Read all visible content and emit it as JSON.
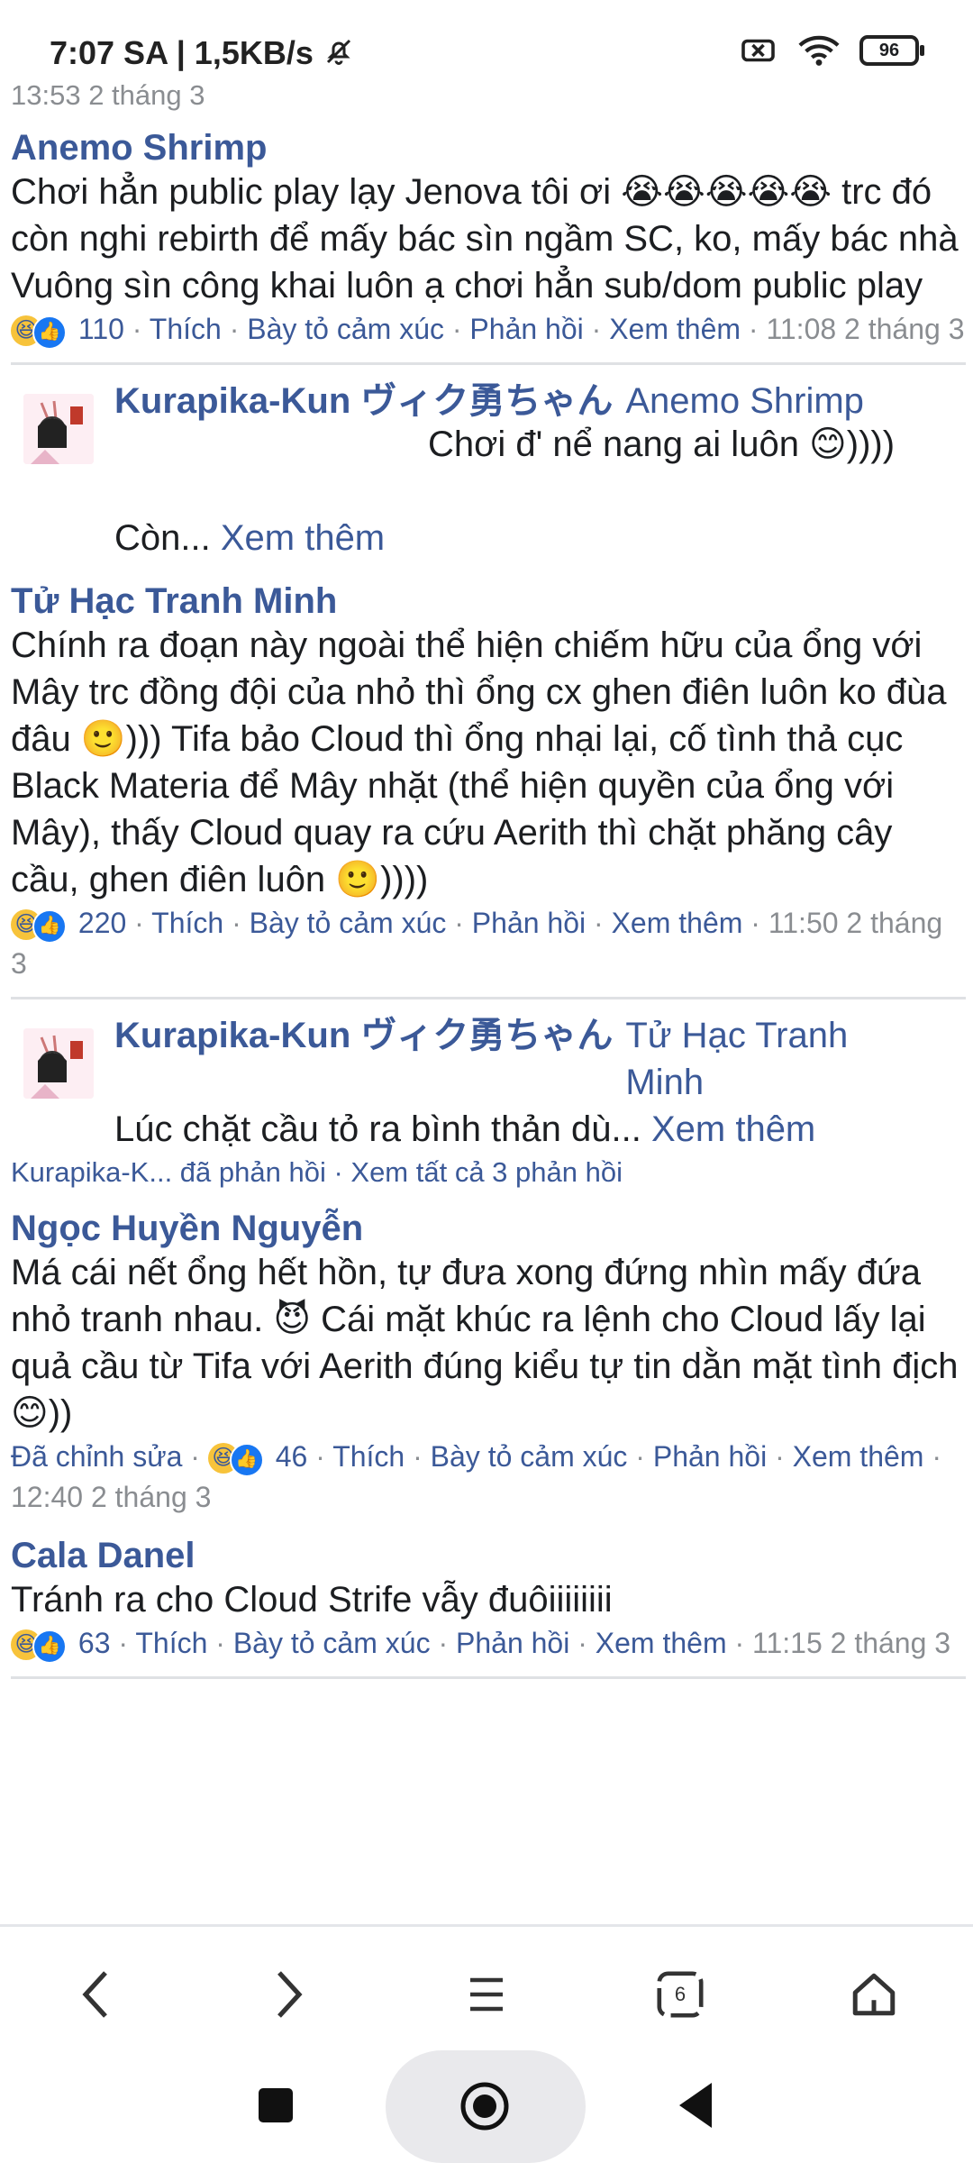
{
  "status_bar": {
    "time_speed": "7:07 SA | 1,5KB/s",
    "battery": "96",
    "icons": [
      "bell-off-icon",
      "battery-x-icon",
      "wifi-icon",
      "battery-icon"
    ]
  },
  "top_timestamp": "13:53 2 tháng 3",
  "comments": [
    {
      "author": "Anemo Shrimp",
      "text_a": "Chơi hẳn public play lạy Jenova tôi ơi ",
      "emojis": "😭😭😭😭😭",
      "text_b": " trc đó còn nghi rebirth để mấy bác sìn ngầm SC, ko, mấy bác nhà Vuông sìn công khai luôn ạ chơi hẳn sub/dom public play",
      "count": "110",
      "like": "Thích",
      "react": "Bày tỏ cảm xúc",
      "reply": "Phản hồi",
      "more": "Xem thêm",
      "time": "11:08 2 tháng 3"
    },
    {
      "author": "Tử Hạc Tranh Minh",
      "text": "Chính ra đoạn này ngoài thể hiện chiếm hữu của ổng với Mây trc đồng đội của nhỏ thì ổng cx ghen điên luôn ko đùa đâu 🙂))) Tifa bảo Cloud thì ổng nhại lại, cố tình thả cục Black Materia để Mây nhặt (thể hiện quyền của ổng với Mây), thấy Cloud quay ra cứu Aerith thì chặt phăng cây cầu, ghen điên luôn 🙂))))",
      "count": "220",
      "like": "Thích",
      "react": "Bày tỏ cảm xúc",
      "reply": "Phản hồi",
      "more": "Xem thêm",
      "time": "11:50 2 tháng 3"
    },
    {
      "author": "Ngọc Huyền Nguyễn",
      "text": "Má cái nết ổng hết hồn, tự đưa xong đứng nhìn mấy đứa nhỏ tranh nhau. 😈 Cái mặt khúc ra lệnh cho Cloud lấy lại quả cầu từ Tifa với Aerith đúng kiểu tự tin dằn mặt tình địch 😊))",
      "edited": "Đã chỉnh sửa",
      "count": "46",
      "like": "Thích",
      "react": "Bày tỏ cảm xúc",
      "reply": "Phản hồi",
      "more": "Xem thêm",
      "time": "12:40 2 tháng 3"
    },
    {
      "author": "Cala Danel",
      "text": "Tránh ra cho Cloud Strife vẫy đuôiiiiiiii",
      "count": "63",
      "like": "Thích",
      "react": "Bày tỏ cảm xúc",
      "reply": "Phản hồi",
      "more": "Xem thêm",
      "time": "11:15 2 tháng 3"
    }
  ],
  "replies": [
    {
      "author": "Kurapika-Kun ヴィク勇ちゃん",
      "mention": "Anemo Shrimp",
      "text_a": "Chơi đ' nể nang ai luôn 😊))))",
      "text_b": "Còn...",
      "more": "Xem thêm"
    },
    {
      "author": "Kurapika-Kun ヴィク勇ちゃん",
      "mention": "Tử Hạc Tranh Minh",
      "text": "Lúc chặt cầu tỏ ra bình thản dù...",
      "more": "Xem thêm",
      "summary": "Kurapika-K... đã phản hồi · Xem tất cả 3 phản hồi"
    }
  ],
  "nav": {
    "tabs_count": "6",
    "icons": [
      "back-icon",
      "forward-icon",
      "menu-icon",
      "tabs-icon",
      "home-icon"
    ]
  },
  "system_nav": {
    "icons": [
      "recents-icon",
      "home-circle-icon",
      "back-triangle-icon"
    ]
  }
}
